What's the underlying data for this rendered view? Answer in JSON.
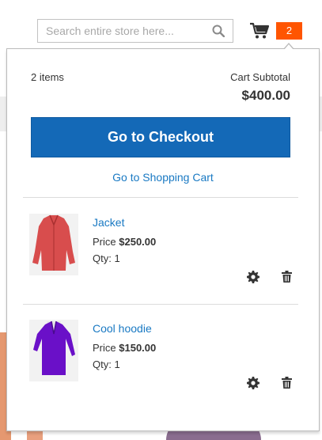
{
  "header": {
    "search": {
      "placeholder": "Search entire store here...",
      "value": ""
    },
    "cart_count": "2"
  },
  "minicart": {
    "items_count": "2 items",
    "subtotal_label": "Cart Subtotal",
    "subtotal_amount": "$400.00",
    "checkout_label": "Go to Checkout",
    "view_cart_label": "Go to Shopping Cart",
    "items": [
      {
        "name": "Jacket",
        "price_label": "Price",
        "price": "$250.00",
        "qty_label": "Qty:",
        "qty": "1",
        "color": "#d9514e"
      },
      {
        "name": "Cool hoodie",
        "price_label": "Price",
        "price": "$150.00",
        "qty_label": "Qty:",
        "qty": "1",
        "color": "#6a10c8"
      }
    ]
  },
  "colors": {
    "accent": "#1469b7",
    "link": "#1979c3",
    "counter": "#ff5501"
  }
}
